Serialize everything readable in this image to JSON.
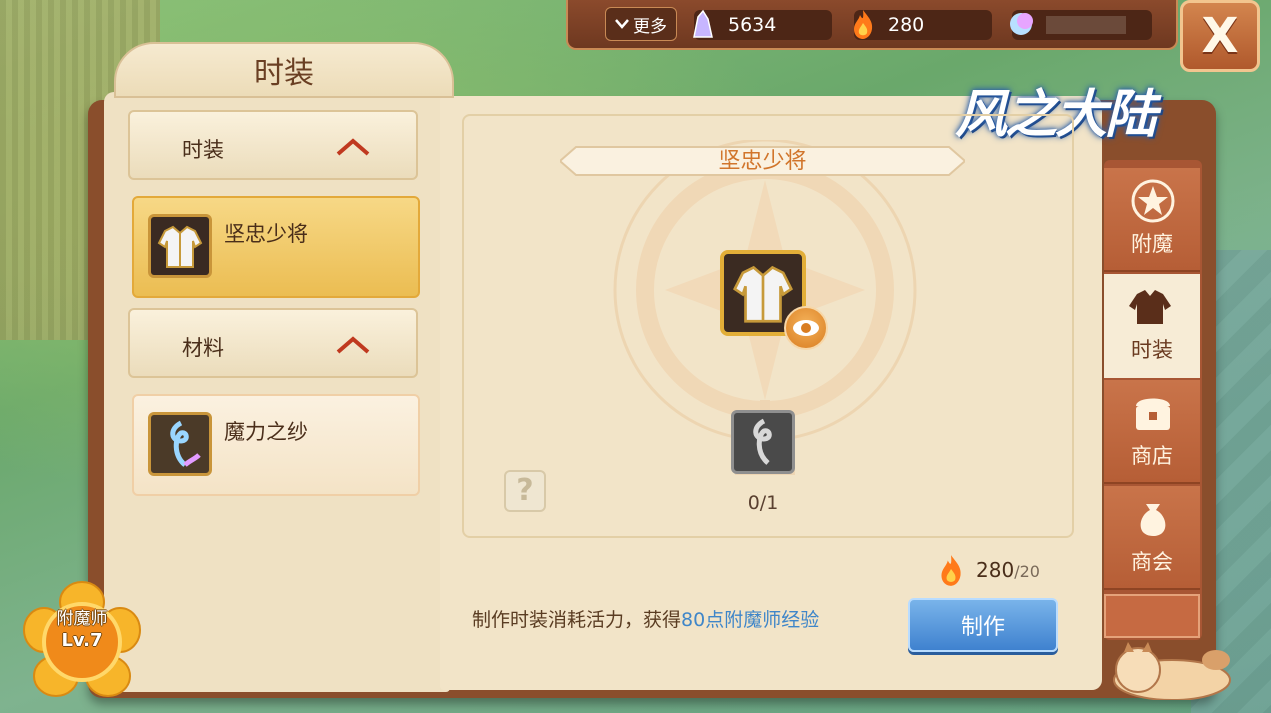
{
  "topbar": {
    "more_label": "更多",
    "crystal_value": "5634",
    "energy_value": "280",
    "moon_value": "",
    "close_label": "X"
  },
  "logo": {
    "text": "风之大陆"
  },
  "left_panel": {
    "title": "时装",
    "categories": [
      {
        "label": "时装",
        "expanded": true,
        "items": [
          {
            "name": "坚忠少将",
            "selected": true
          }
        ]
      },
      {
        "label": "材料",
        "expanded": true,
        "items": [
          {
            "name": "魔力之纱",
            "selected": false
          }
        ]
      }
    ]
  },
  "detail": {
    "item_title": "坚忠少将",
    "material_count": "0/1",
    "help_label": "?"
  },
  "craft": {
    "energy_have": "280",
    "energy_cost": "/20",
    "info_prefix": "制作时装消耗活力，获得",
    "info_highlight": "80点附魔师经验",
    "make_label": "制作"
  },
  "side_tabs": [
    {
      "label": "附魔",
      "active": false
    },
    {
      "label": "时装",
      "active": true
    },
    {
      "label": "商店",
      "active": false
    },
    {
      "label": "商会",
      "active": false
    }
  ],
  "badge": {
    "title": "附魔师",
    "level": "Lv.7"
  },
  "colors": {
    "accent_orange": "#d1752b",
    "highlight_blue": "#3f86c9",
    "button_blue": "#3f82cf",
    "selected_gold": "#ebbd52"
  }
}
